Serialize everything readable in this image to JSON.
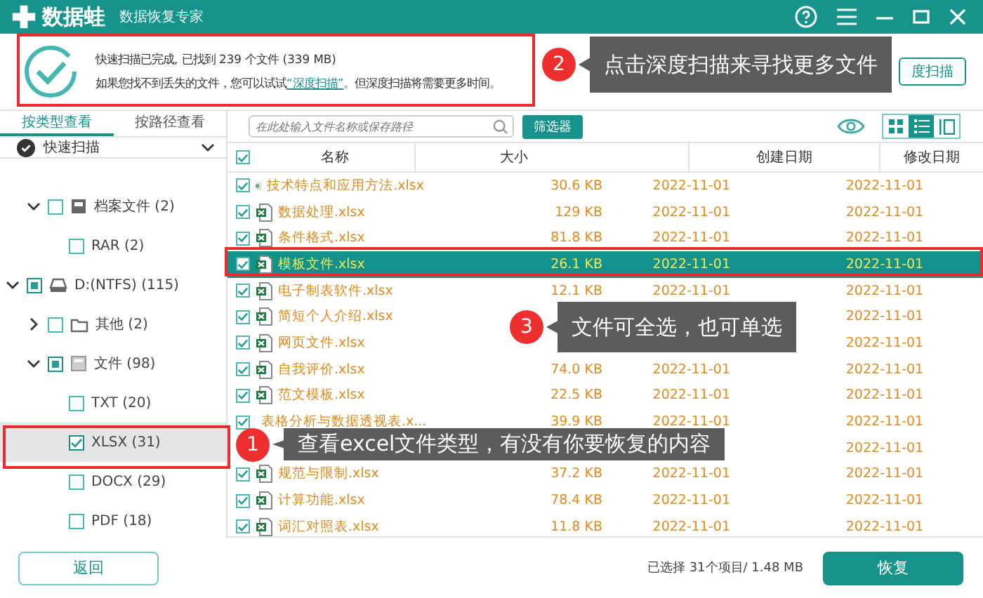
{
  "app": {
    "name": "数据蛙",
    "subtitle": "数据恢复专家"
  },
  "summary": {
    "line1": "快速扫描已完成, 已找到 239 个文件 (339 MB)",
    "line2_before": "如果您找不到丢失的文件，您可以试试",
    "link": "“深度扫描”",
    "line2_after": "。但深度扫描将需要更多时间。"
  },
  "deep_scan_button": "度扫描",
  "view_tabs": [
    {
      "label": "按类型查看",
      "selected": true
    },
    {
      "label": "按路径查看",
      "selected": false
    }
  ],
  "scan_dropdown": "快速扫描",
  "tree": [
    {
      "kind": "archive",
      "label": "档案文件 (2)",
      "checked": false,
      "partial": false,
      "expanded": true,
      "selected": false,
      "children": [
        {
          "label": "RAR (2)",
          "checked": false,
          "partial": false,
          "selected": false
        }
      ]
    },
    {
      "kind": "drive",
      "label": "D:(NTFS) (115)",
      "checked": true,
      "partial": true,
      "expanded": true,
      "selected": false,
      "children": [
        {
          "kind": "folder",
          "label": "其他 (2)",
          "checked": false,
          "partial": false,
          "expanded": false,
          "selected": false
        },
        {
          "kind": "doc",
          "label": "文件 (98)",
          "checked": true,
          "partial": true,
          "expanded": true,
          "selected": false,
          "children": [
            {
              "label": "TXT (20)",
              "checked": false,
              "partial": false,
              "selected": false
            },
            {
              "label": "XLSX (31)",
              "checked": true,
              "partial": false,
              "selected": true
            },
            {
              "label": "DOCX (29)",
              "checked": false,
              "partial": false,
              "selected": false
            },
            {
              "label": "PDF (18)",
              "checked": false,
              "partial": false,
              "selected": false
            }
          ]
        }
      ]
    }
  ],
  "search": {
    "placeholder": "在此处输入文件名称或保存路径"
  },
  "filter_button": "筛选器",
  "view_modes": [
    {
      "kind": "grid",
      "selected": false
    },
    {
      "kind": "list",
      "selected": true
    },
    {
      "kind": "preview",
      "selected": false
    }
  ],
  "table": {
    "columns": [
      "名称",
      "大小",
      "创建日期",
      "修改日期"
    ],
    "all_checked": true,
    "rows": [
      {
        "name": "技术特点和应用方法.xlsx",
        "size": "30.6 KB",
        "created": "2022-11-01",
        "modified": "2022-11-01",
        "checked": true,
        "selected": false
      },
      {
        "name": "数据处理.xlsx",
        "size": "129 KB",
        "created": "2022-11-01",
        "modified": "2022-11-01",
        "checked": true,
        "selected": false
      },
      {
        "name": "条件格式.xlsx",
        "size": "81.8 KB",
        "created": "2022-11-01",
        "modified": "2022-11-01",
        "checked": true,
        "selected": false
      },
      {
        "name": "模板文件.xlsx",
        "size": "26.1 KB",
        "created": "2022-11-01",
        "modified": "2022-11-01",
        "checked": true,
        "selected": true
      },
      {
        "name": "电子制表软件.xlsx",
        "size": "12.1 KB",
        "created": "2022-11-01",
        "modified": "2022-11-01",
        "checked": true,
        "selected": false
      },
      {
        "name": "简短个人介绍.xlsx",
        "modified": "2022-11-01",
        "checked": true,
        "selected": false
      },
      {
        "name": "网页文件.xlsx",
        "modified": "2022-11-01",
        "checked": true,
        "selected": false
      },
      {
        "name": "自我评价.xlsx",
        "size": "74.0 KB",
        "created": "2022-11-01",
        "modified": "2022-11-01",
        "checked": true,
        "selected": false
      },
      {
        "name": "范文模板.xlsx",
        "size": "22.5 KB",
        "created": "2022-11-01",
        "modified": "2022-11-01",
        "checked": true,
        "selected": false
      },
      {
        "name": "表格分析与数据透视表.x...",
        "size": "39.9 KB",
        "created": "2022-11-01",
        "modified": "2022-11-01",
        "checked": true,
        "selected": false
      },
      {
        "modified": "2022-11-01",
        "selected": false
      },
      {
        "name": "规范与限制.xlsx",
        "size": "37.2 KB",
        "created": "2022-11-01",
        "modified": "2022-11-01",
        "checked": true,
        "selected": false
      },
      {
        "name": "计算功能.xlsx",
        "size": "78.4 KB",
        "created": "2022-11-01",
        "modified": "2022-11-01",
        "checked": true,
        "selected": false
      },
      {
        "name": "词汇对照表.xlsx",
        "size": "11.8 KB",
        "created": "2022-11-01",
        "modified": "2022-11-01",
        "checked": true,
        "selected": false
      }
    ]
  },
  "status": "已选择 31个项目/ 1.48 MB",
  "back_button": "返回",
  "recover_button": "恢复",
  "callouts": [
    {
      "number": "1",
      "text": "查看excel文件类型，有没有你要恢复的内容"
    },
    {
      "number": "2",
      "text": "点击深度扫描来寻找更多文件"
    },
    {
      "number": "3",
      "text": "文件可全选，也可单选"
    }
  ]
}
